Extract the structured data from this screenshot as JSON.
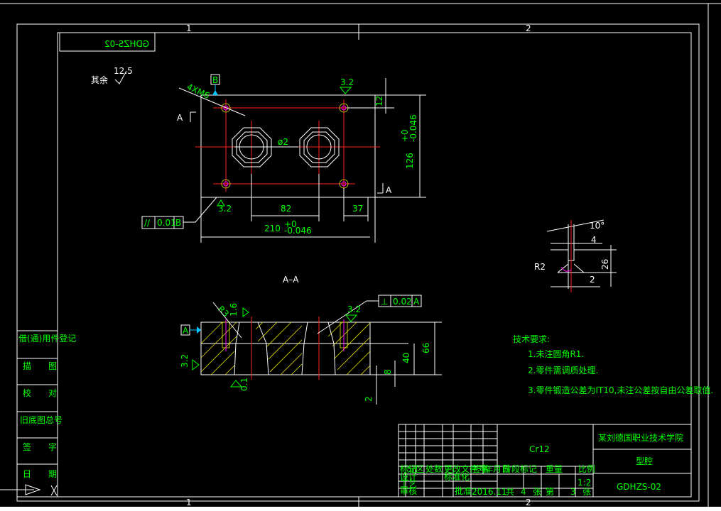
{
  "drawing": {
    "mirrored_code": "GDHZS-02",
    "zone_top_1": "1",
    "zone_top_2": "2",
    "zone_bottom_1": "1",
    "zone_bottom_2": "2",
    "remaining_label": "其余",
    "remaining_roughness": "12.5",
    "datum_b": "B",
    "datum_a": "A",
    "tapped_holes": "4XM6",
    "roughness_32": "3.2",
    "diameter_note": "ø2",
    "dim_12": "12",
    "dim_126": "126",
    "dim_126_tol": "+0\n-0.046",
    "dim_82": "82",
    "dim_37": "37",
    "dim_210": "210",
    "dim_210_tol_up": "+0",
    "dim_210_tol_low": "-0.046",
    "flatness_symbol": "//",
    "flatness_value": "0.01",
    "flatness_datum": "B",
    "section_label": "A–A",
    "section_mark_a": "A",
    "detail_angle": "10°",
    "detail_4": "4",
    "detail_26": "26",
    "detail_2": "2",
    "detail_r2": "R2",
    "r3": "R3",
    "roughness_16": "1.6",
    "perp_symbol": "⊥",
    "perp_value": "0.02",
    "perp_datum": "A",
    "dim_66": "66",
    "dim_40": "40",
    "dim_8": "8",
    "dim_2b": "2",
    "roughness_01": "0.1",
    "tech_title": "技术要求:",
    "tech_1": "1.未注圆角R1.",
    "tech_2": "2.零件需调质处理.",
    "tech_3": "3.零件锻造公差为IT10,未注公差按自由公差取值.",
    "side_labels": [
      "借(通)用件登记",
      "描　　图",
      "校　　对",
      "旧底图总号",
      "签　　字",
      "日　　期"
    ],
    "material": "Cr12",
    "school": "某刘德国职业技术学院",
    "part_name": "型腔",
    "drawing_no": "GDHZS-02",
    "scale": "1:2",
    "date": "2016.11",
    "sheets_a": "4",
    "sheets_b": "3",
    "tb_labels": [
      "标记",
      "处数",
      "分区",
      "更改文件号",
      "签名",
      "年月日"
    ],
    "tb_labels2": [
      "设计",
      "标准化",
      "审核",
      "工艺",
      "批准"
    ],
    "tb_labels3": [
      "阶段标记",
      "重量",
      "比例"
    ],
    "tb_sheet": [
      "共",
      "张",
      "第",
      "张"
    ]
  },
  "colors": {
    "background": "#000000",
    "frame": "#ffffff",
    "dimension": "#00ff00",
    "centerline": "#ff2020",
    "hatch": "#e6e600",
    "datum": "#00c8ff"
  }
}
